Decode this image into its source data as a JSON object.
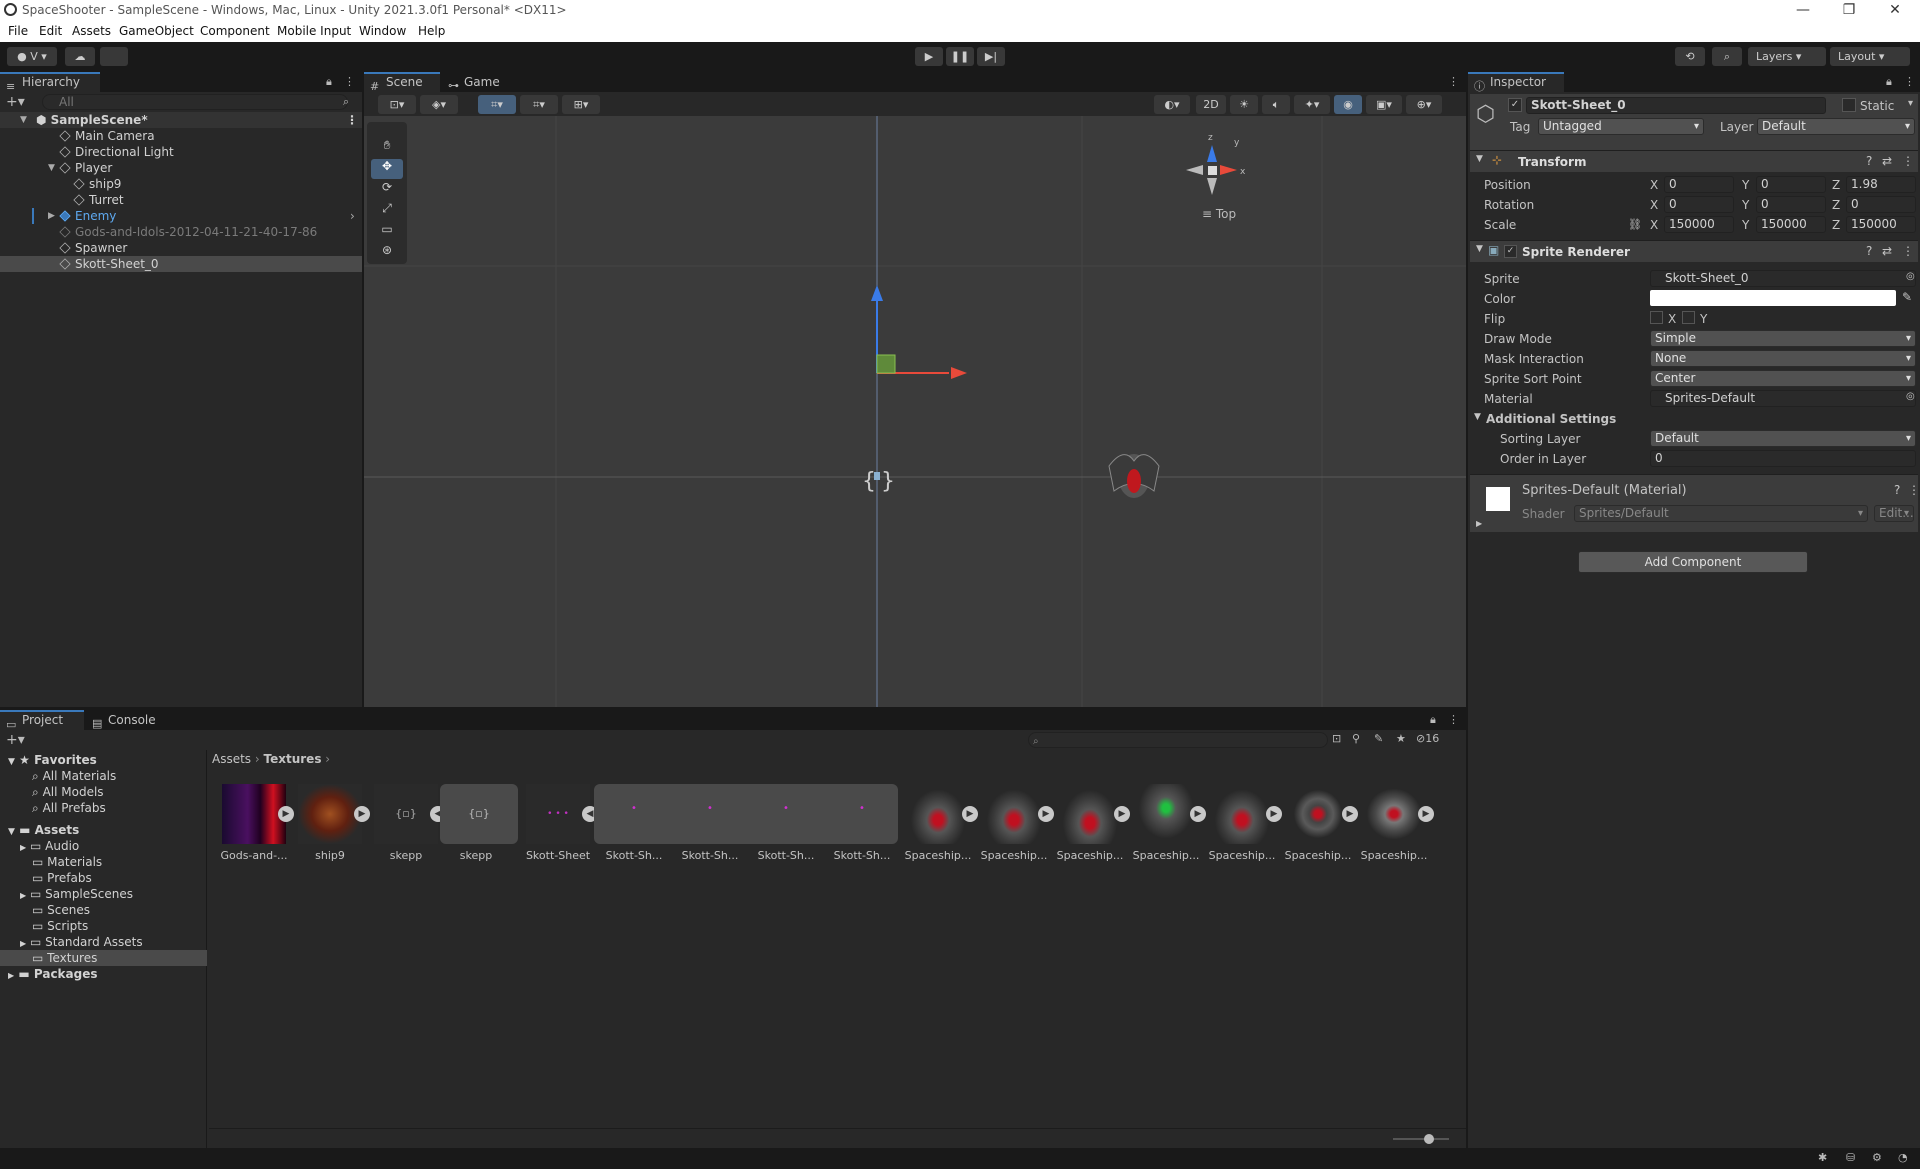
{
  "window": {
    "title": "SpaceShooter - SampleScene - Windows, Mac, Linux - Unity 2021.3.0f1 Personal* <DX11>",
    "minimize": "—",
    "maximize": "❐",
    "close": "✕"
  },
  "menu": [
    "File",
    "Edit",
    "Assets",
    "GameObject",
    "Component",
    "Mobile Input",
    "Window",
    "Help"
  ],
  "toolbar": {
    "account": "V",
    "layers": "Layers",
    "layout": "Layout"
  },
  "hierarchy": {
    "tab": "Hierarchy",
    "search_placeholder": "All",
    "scene": "SampleScene*",
    "items": [
      "Main Camera",
      "Directional Light",
      "Player",
      "ship9",
      "Turret",
      "Enemy",
      "Gods-and-Idols-2012-04-11-21-40-17-86",
      "Spawner",
      "Skott-Sheet_0"
    ]
  },
  "scene": {
    "tab_scene": "Scene",
    "tab_game": "Game",
    "btn_2d": "2D",
    "gizmo_label": "Top",
    "axis_x": "x",
    "axis_y": "y",
    "axis_z": "z"
  },
  "inspector": {
    "tab": "Inspector",
    "object_name": "Skott-Sheet_0",
    "static_label": "Static",
    "tag_label": "Tag",
    "tag_value": "Untagged",
    "layer_label": "Layer",
    "layer_value": "Default",
    "transform": {
      "title": "Transform",
      "position_label": "Position",
      "rotation_label": "Rotation",
      "scale_label": "Scale",
      "pos": {
        "x": "0",
        "y": "0",
        "z": "1.98"
      },
      "rot": {
        "x": "0",
        "y": "0",
        "z": "0"
      },
      "scale": {
        "x": "150000",
        "y": "150000",
        "z": "150000"
      },
      "x": "X",
      "y": "Y",
      "z": "Z"
    },
    "sprite_renderer": {
      "title": "Sprite Renderer",
      "sprite_label": "Sprite",
      "sprite_value": "Skott-Sheet_0",
      "color_label": "Color",
      "flip_label": "Flip",
      "flip_x": "X",
      "flip_y": "Y",
      "draw_mode_label": "Draw Mode",
      "draw_mode": "Simple",
      "mask_label": "Mask Interaction",
      "mask": "None",
      "sort_point_label": "Sprite Sort Point",
      "sort_point": "Center",
      "material_label": "Material",
      "material": "Sprites-Default",
      "additional": "Additional Settings",
      "sorting_layer_label": "Sorting Layer",
      "sorting_layer": "Default",
      "order_label": "Order in Layer",
      "order": "0"
    },
    "material": {
      "title": "Sprites-Default (Material)",
      "shader_label": "Shader",
      "shader": "Sprites/Default",
      "edit": "Edit..."
    },
    "add_component": "Add Component"
  },
  "project": {
    "tab_project": "Project",
    "tab_console": "Console",
    "favorites": "Favorites",
    "fav_items": [
      "All Materials",
      "All Models",
      "All Prefabs"
    ],
    "assets": "Assets",
    "asset_folders": [
      "Audio",
      "Materials",
      "Prefabs",
      "SampleScenes",
      "Scenes",
      "Scripts",
      "Standard Assets",
      "Textures"
    ],
    "packages": "Packages",
    "breadcrumb_root": "Assets",
    "breadcrumb_current": "Textures",
    "hidden_count": "16",
    "files": [
      "Gods-and-...",
      "ship9",
      "skepp",
      "skepp",
      "Skott-Sheet",
      "Skott-Sh...",
      "Skott-Sh...",
      "Skott-Sh...",
      "Skott-Sh...",
      "Spaceship...",
      "Spaceship...",
      "Spaceship...",
      "Spaceship...",
      "Spaceship...",
      "Spaceship...",
      "Spaceship..."
    ]
  }
}
